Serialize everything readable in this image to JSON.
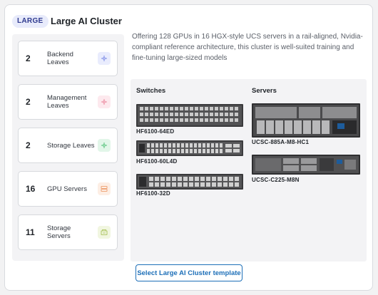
{
  "header": {
    "badge": "LARGE",
    "title": "Large AI Cluster"
  },
  "stats": [
    {
      "count": "2",
      "label": "Backend Leaves",
      "icon": "leaf-switch-icon",
      "icon_bg": "#e9ecfd",
      "icon_color": "#8e9bea"
    },
    {
      "count": "2",
      "label": "Management Leaves",
      "icon": "management-switch-icon",
      "icon_bg": "#fde9ee",
      "icon_color": "#ee97aa"
    },
    {
      "count": "2",
      "label": "Storage Leaves",
      "icon": "storage-switch-icon",
      "icon_bg": "#e2f6e9",
      "icon_color": "#6dcb8e"
    },
    {
      "count": "16",
      "label": "GPU Servers",
      "icon": "server-icon",
      "icon_bg": "#fdeee4",
      "icon_color": "#efa77c"
    },
    {
      "count": "11",
      "label": "Storage Servers",
      "icon": "storage-server-icon",
      "icon_bg": "#f1f6e0",
      "icon_color": "#b3c96d"
    }
  ],
  "description": "Offering 128 GPUs in 16 HGX-style UCS servers in a rail-aligned, Nvidia-compliant reference architecture, this cluster is well-suited training and fine-tuning large-sized models",
  "hardware": {
    "switches_heading": "Switches",
    "servers_heading": "Servers",
    "switches": [
      {
        "model": "HF6100-64ED",
        "image": "switch-64ed-image"
      },
      {
        "model": "HF6100-60L4D",
        "image": "switch-60l4d-image"
      },
      {
        "model": "HF6100-32D",
        "image": "switch-32d-image"
      }
    ],
    "servers": [
      {
        "model": "UCSC-885A-M8-HC1",
        "image": "server-885a-image"
      },
      {
        "model": "UCSC-C225-M8N",
        "image": "server-c225-image"
      }
    ]
  },
  "actions": {
    "select_template": "Select Large AI Cluster template"
  }
}
